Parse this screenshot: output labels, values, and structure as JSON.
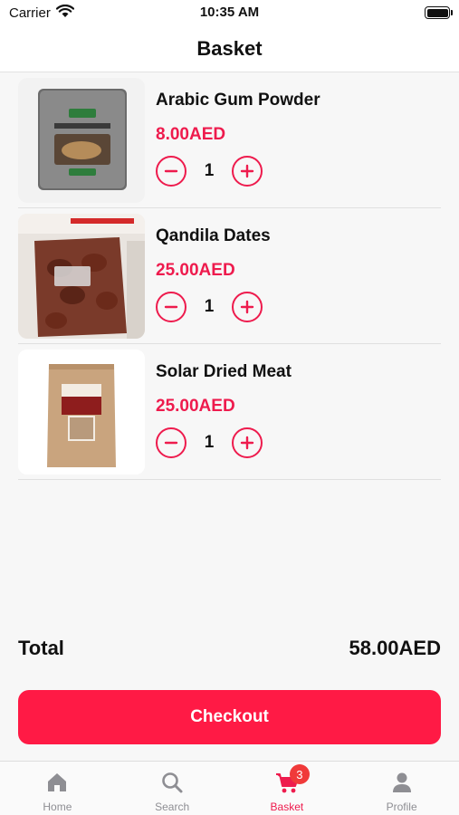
{
  "status_bar": {
    "carrier": "Carrier",
    "time": "10:35 AM"
  },
  "header": {
    "title": "Basket"
  },
  "basket": {
    "items": [
      {
        "name": "Arabic Gum Powder",
        "price": "8.00AED",
        "quantity": "1",
        "image": "gum-powder-pack"
      },
      {
        "name": "Qandila Dates",
        "price": "25.00AED",
        "quantity": "1",
        "image": "dates-bag"
      },
      {
        "name": "Solar Dried Meat",
        "price": "25.00AED",
        "quantity": "1",
        "image": "dried-meat-pouch"
      }
    ],
    "total_label": "Total",
    "total_value": "58.00AED",
    "checkout_label": "Checkout"
  },
  "tabs": [
    {
      "label": "Home",
      "icon": "home-icon",
      "active": false
    },
    {
      "label": "Search",
      "icon": "search-icon",
      "active": false
    },
    {
      "label": "Basket",
      "icon": "cart-icon",
      "active": true,
      "badge": "3"
    },
    {
      "label": "Profile",
      "icon": "profile-icon",
      "active": false
    }
  ],
  "colors": {
    "accent": "#ee1b4d",
    "checkout_bg": "#ff1a45",
    "badge": "#f03a3a",
    "inactive_tab": "#8e8e93"
  }
}
